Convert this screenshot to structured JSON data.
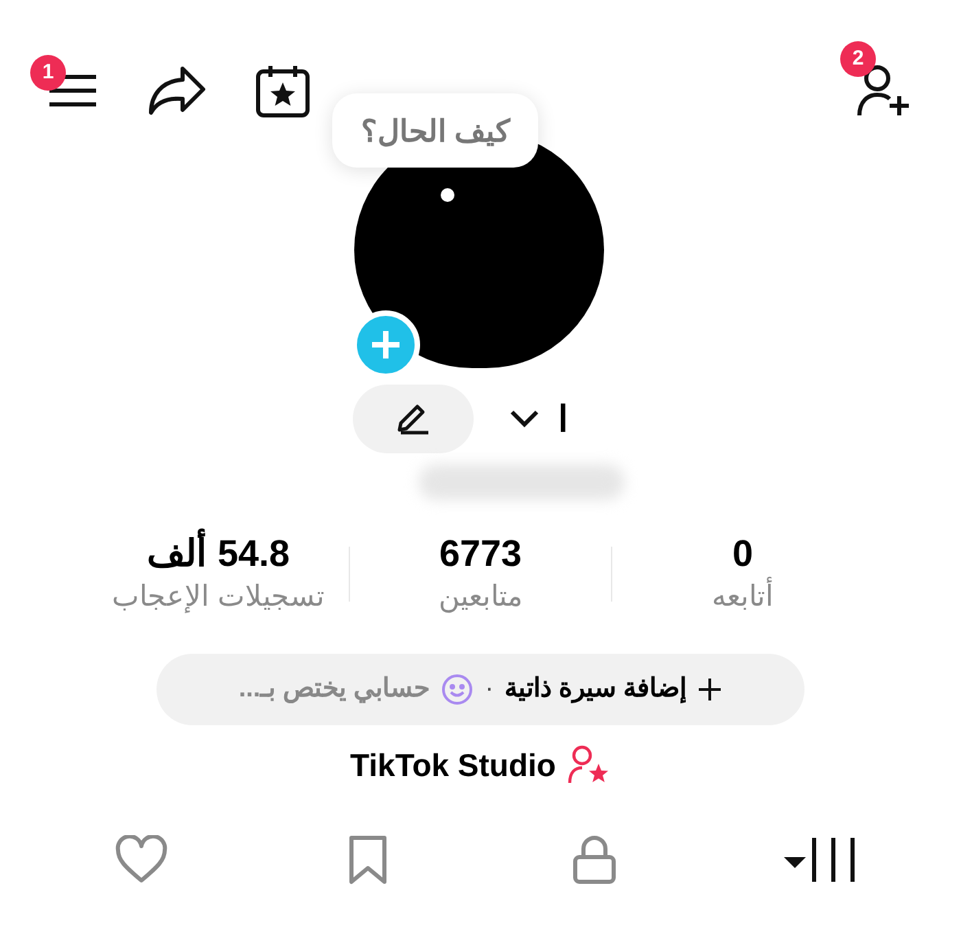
{
  "top_bar": {
    "menu_badge": "1",
    "add_friend_badge": "2"
  },
  "avatar": {
    "note": "كيف الحال؟"
  },
  "profile": {
    "name": "ا"
  },
  "stats": [
    {
      "value": "0",
      "label": "أتابعه"
    },
    {
      "value": "6773",
      "label": "متابعين"
    },
    {
      "value": "54.8 ألف",
      "label": "تسجيلات الإعجاب"
    }
  ],
  "bio": {
    "add_label": "إضافة سيرة ذاتية",
    "separator": "·",
    "suggestion": "حسابي يختص بـ..."
  },
  "studio_link": "TikTok Studio",
  "tabs": [
    {
      "kind": "videos",
      "selected": true
    },
    {
      "kind": "private",
      "selected": false
    },
    {
      "kind": "saved",
      "selected": false
    },
    {
      "kind": "liked",
      "selected": false
    }
  ]
}
